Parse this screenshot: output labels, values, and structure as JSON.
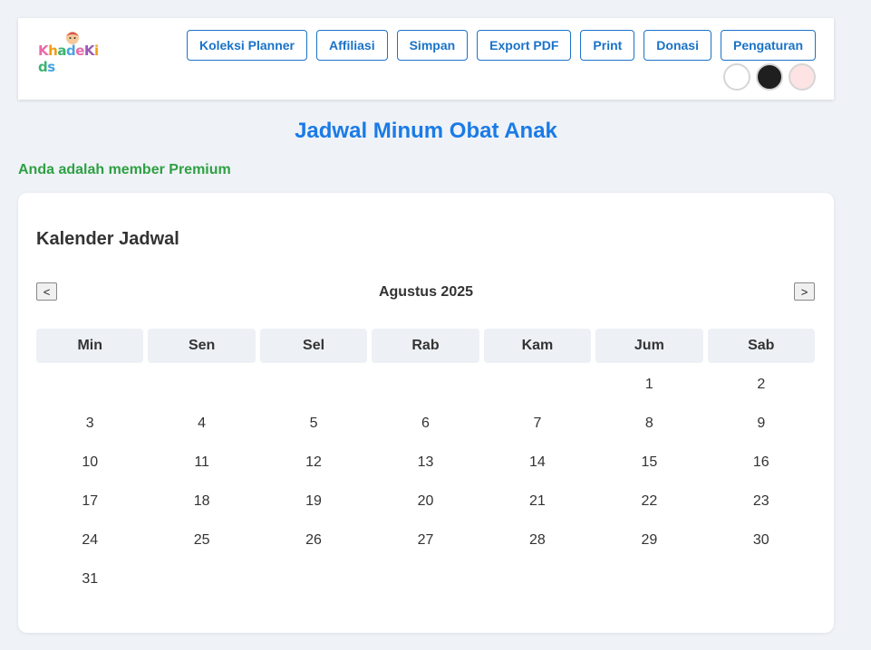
{
  "header": {
    "logo_text": "KhadeKids",
    "nav": [
      {
        "label": "Koleksi Planner",
        "name": "koleksi-planner-button"
      },
      {
        "label": "Affiliasi",
        "name": "affiliasi-button"
      },
      {
        "label": "Simpan",
        "name": "simpan-button"
      },
      {
        "label": "Export PDF",
        "name": "export-pdf-button"
      },
      {
        "label": "Print",
        "name": "print-button"
      },
      {
        "label": "Donasi",
        "name": "donasi-button"
      },
      {
        "label": "Pengaturan",
        "name": "pengaturan-button"
      }
    ],
    "themes": [
      {
        "name": "theme-white",
        "color": "#ffffff"
      },
      {
        "name": "theme-black",
        "color": "#1f1f1f"
      },
      {
        "name": "theme-pink",
        "color": "#fde3e3"
      }
    ]
  },
  "page_title": "Jadwal Minum Obat Anak",
  "member_status": "Anda adalah member Premium",
  "calendar": {
    "title": "Kalender Jadwal",
    "prev_label": "<",
    "next_label": ">",
    "month_label": "Agustus 2025",
    "weekdays": [
      "Min",
      "Sen",
      "Sel",
      "Rab",
      "Kam",
      "Jum",
      "Sab"
    ],
    "days": [
      "",
      "",
      "",
      "",
      "",
      "1",
      "2",
      "3",
      "4",
      "5",
      "6",
      "7",
      "8",
      "9",
      "10",
      "11",
      "12",
      "13",
      "14",
      "15",
      "16",
      "17",
      "18",
      "19",
      "20",
      "21",
      "22",
      "23",
      "24",
      "25",
      "26",
      "27",
      "28",
      "29",
      "30",
      "31",
      "",
      "",
      "",
      "",
      "",
      ""
    ]
  }
}
